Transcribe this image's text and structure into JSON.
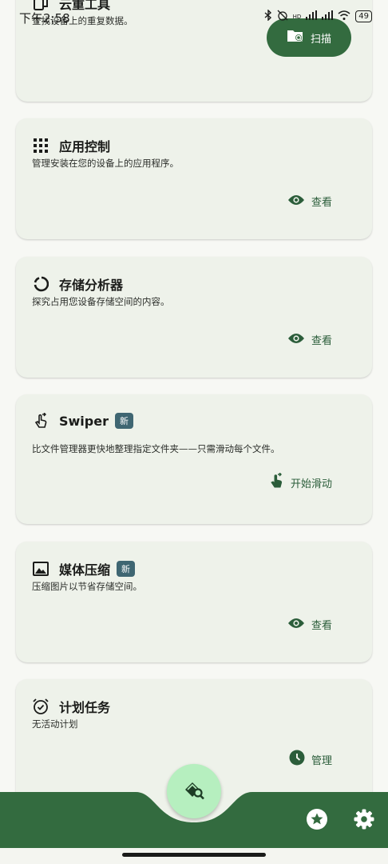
{
  "status_bar": {
    "time": "下午2:58",
    "signal": "HD",
    "battery": "49"
  },
  "cards": [
    {
      "title": "云重工具",
      "description": "查找设备上的重复数据。",
      "icon": "duplicate-icon",
      "action_label": "扫描",
      "action_icon": "folder-search-icon"
    },
    {
      "title": "应用控制",
      "description": "管理安装在您的设备上的应用程序。",
      "icon": "apps-grid-icon",
      "action_label": "查看",
      "action_icon": "eye-icon"
    },
    {
      "title": "存储分析器",
      "description": "探究占用您设备存储空间的内容。",
      "icon": "donut-chart-icon",
      "action_label": "查看",
      "action_icon": "eye-icon"
    },
    {
      "title": "Swiper",
      "badge": "新",
      "description": "比文件管理器更快地整理指定文件夹——只需滑动每个文件。",
      "icon": "swipe-hand-icon",
      "action_label": "开始滑动",
      "action_icon": "swipe-hand-icon"
    },
    {
      "title": "媒体压缩",
      "badge": "新",
      "description": "压缩图片以节省存储空间。",
      "icon": "image-icon",
      "action_label": "查看",
      "action_icon": "eye-icon"
    },
    {
      "title": "计划任务",
      "description": "无活动计划",
      "icon": "alarm-check-icon",
      "action_label": "管理",
      "action_icon": "clock-icon"
    }
  ],
  "bottom_bar": {
    "fab_icon": "clean-search-icon",
    "favorites_icon": "star-icon",
    "settings_icon": "gear-icon"
  },
  "colors": {
    "primary": "#336b3f",
    "bar": "#336b3f",
    "fab": "#b6efbf",
    "card": "#eef2ea",
    "action_text": "#2b5d3a",
    "badge": "#3f6672"
  }
}
